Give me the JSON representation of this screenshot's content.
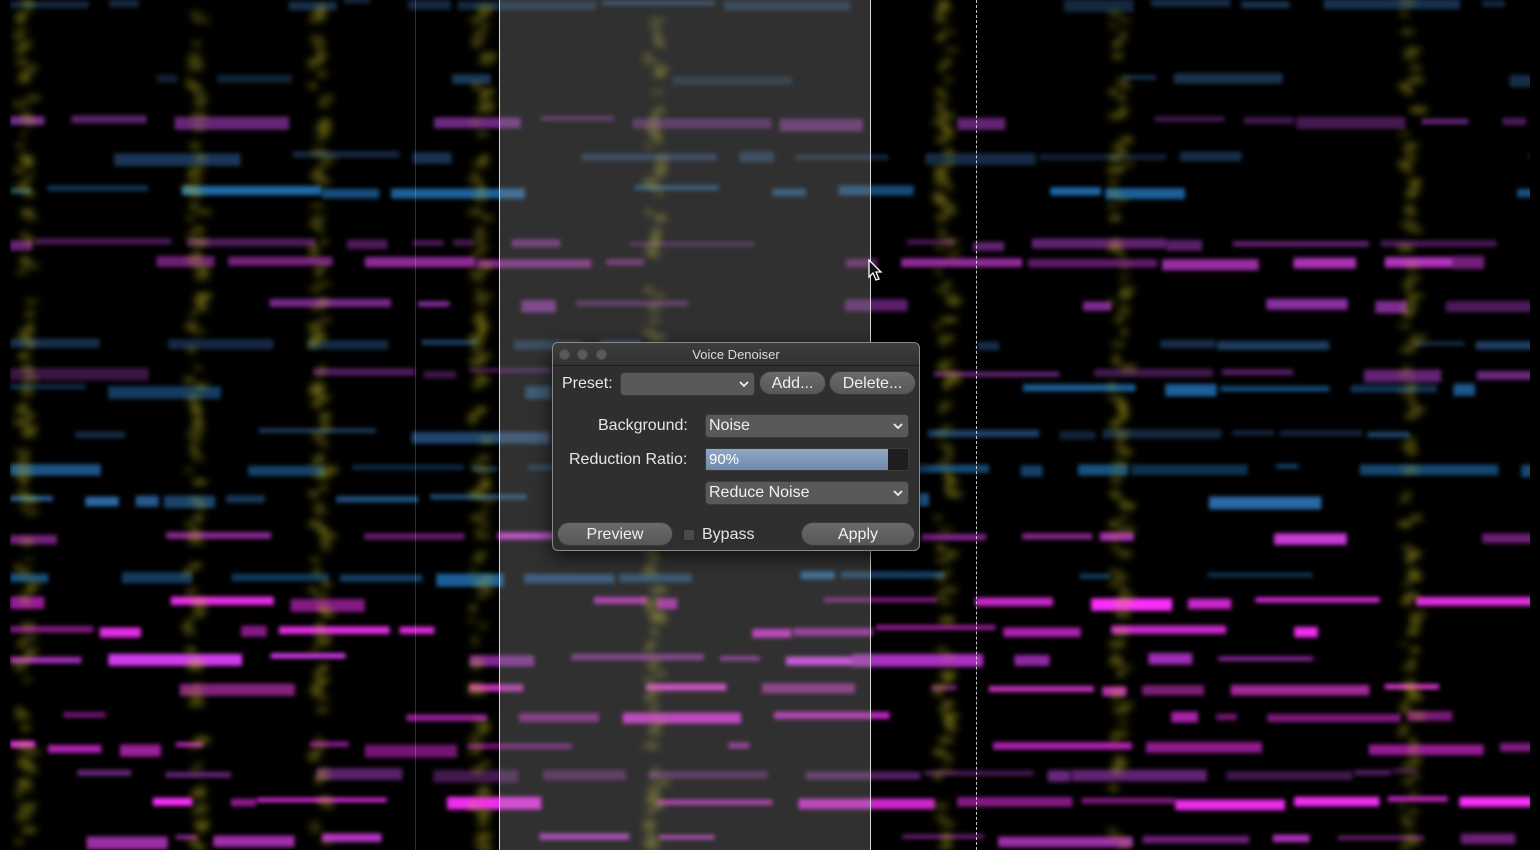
{
  "window": {
    "title": "Voice Denoiser"
  },
  "preset": {
    "label": "Preset:",
    "value": "",
    "add_label": "Add...",
    "delete_label": "Delete..."
  },
  "background": {
    "label": "Background:",
    "value": "Noise"
  },
  "reduction_ratio": {
    "label": "Reduction Ratio:",
    "value_text": "90%",
    "value": 0.9
  },
  "mode": {
    "value": "Reduce Noise"
  },
  "footer": {
    "preview_label": "Preview",
    "bypass_label": "Bypass",
    "bypass_checked": false,
    "apply_label": "Apply"
  },
  "colors": {
    "selection": "#969696",
    "slider_fill": "#7f98b8",
    "dialog_bg": "#2f2f2f"
  },
  "icons": [
    "close-window-icon",
    "minimize-window-icon",
    "zoom-window-icon",
    "chevron-down-icon",
    "mouse-pointer-icon"
  ]
}
